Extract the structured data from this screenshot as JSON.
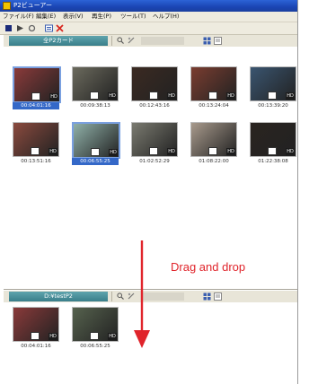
{
  "window": {
    "title": "P2ビューアー"
  },
  "menu": [
    "ファイル(F)",
    "編集(E)",
    "表示(V)",
    "再生(P)",
    "ツール(T)",
    "ヘルプ(H)"
  ],
  "toolbar": {
    "icons": [
      "stop-icon",
      "play-icon",
      "loop-icon",
      "list-icon",
      "delete-x-icon"
    ]
  },
  "top_panel": {
    "drive_label": "全P2カード",
    "clips": [
      {
        "timecode": "00:04:01:16",
        "selected": true,
        "color": "#8a3a3a"
      },
      {
        "timecode": "00:09:38:13",
        "selected": false,
        "color": "#6b6a5d"
      },
      {
        "timecode": "00:12:43:16",
        "selected": false,
        "color": "#3b2a22"
      },
      {
        "timecode": "00:13:24:04",
        "selected": false,
        "color": "#7a3d30"
      },
      {
        "timecode": "00:13:39:20",
        "selected": false,
        "color": "#3a5570"
      },
      {
        "timecode": "00:13:51:16",
        "selected": false,
        "color": "#8a4a3e"
      },
      {
        "timecode": "00:06:55:25",
        "selected": true,
        "color": "#8fb0a8"
      },
      {
        "timecode": "01:02:52:29",
        "selected": false,
        "color": "#7a7a70"
      },
      {
        "timecode": "01:08:22:00",
        "selected": false,
        "color": "#a89a8c"
      },
      {
        "timecode": "01:22:38:08",
        "selected": false,
        "color": "#2a2420"
      }
    ]
  },
  "bottom_panel": {
    "drive_label": "D:¥testP2",
    "clips": [
      {
        "timecode": "00:04:01:16",
        "selected": false,
        "color": "#8a3a3a"
      },
      {
        "timecode": "00:06:55:25",
        "selected": false,
        "color": "#56624e"
      }
    ]
  },
  "annotation": {
    "text": "Drag and drop",
    "color": "#e0242b"
  },
  "colors": {
    "titlebar": "#1a45b4",
    "selection": "#3468c8",
    "drive_pill": "#4a8f99"
  }
}
